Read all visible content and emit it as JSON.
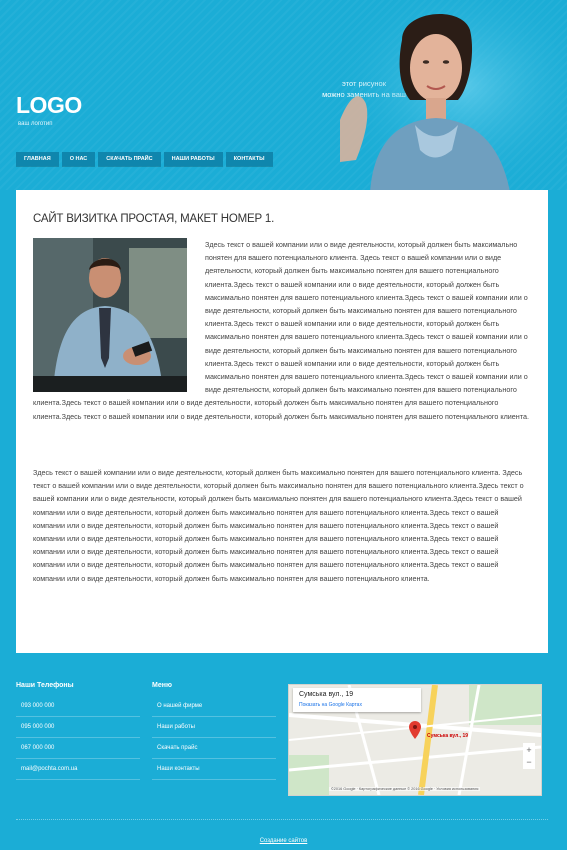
{
  "header": {
    "logo": "LOGO",
    "logo_sub": "ваш логотип",
    "hero_caption_line1": "этот рисунок",
    "hero_caption_line2": "можно заменить на ваш",
    "nav": [
      {
        "label": "ГЛАВНАЯ"
      },
      {
        "label": "О НАС"
      },
      {
        "label": "СКАЧАТЬ ПРАЙС"
      },
      {
        "label": "НАШИ РАБОТЫ"
      },
      {
        "label": "КОНТАКТЫ"
      }
    ]
  },
  "content": {
    "title": "САЙТ ВИЗИТКА ПРОСТАЯ, МАКЕТ НОМЕР 1.",
    "paragraph1": "Здесь текст о вашей компании или о виде деятельности, который должен быть максимально понятен для вашего потенциального клиента. Здесь текст о вашей компании или о виде деятельности, который должен быть максимально понятен для вашего потенциального клиента.Здесь текст о вашей компании или о виде деятельности, который должен быть максимально понятен для вашего потенциального клиента.Здесь текст о вашей компании или о виде деятельности, который должен быть максимально понятен для вашего потенциального клиента.Здесь текст о вашей компании или о виде деятельности, который должен быть максимально понятен для вашего потенциального клиента.Здесь текст о вашей компании или о виде деятельности, который должен быть максимально понятен для вашего потенциального клиента.Здесь текст о вашей компании или о виде деятельности, который должен быть максимально понятен для вашего потенциального клиента.Здесь текст о вашей компании или о виде деятельности, который должен быть максимально понятен для вашего потенциального клиента.Здесь текст о вашей компании или о виде деятельности, который должен быть максимально понятен для вашего потенциального клиента.Здесь текст о вашей компании или о виде деятельности, который должен быть максимально понятен для вашего потенциального клиента.",
    "paragraph2": "Здесь текст о вашей компании или о виде деятельности, который должен быть максимально понятен для вашего потенциального клиента. Здесь текст о вашей компании или о виде деятельности, который должен быть максимально понятен для вашего потенциального клиента.Здесь текст о вашей компании или о виде деятельности, который должен быть максимально понятен для вашего потенциального клиента.Здесь текст о вашей компании или о виде деятельности, который должен быть максимально понятен для вашего потенциального клиента.Здесь текст о вашей компании или о виде деятельности, который должен быть максимально понятен для вашего потенциального клиента.Здесь текст о вашей компании или о виде деятельности, который должен быть максимально понятен для вашего потенциального клиента.Здесь текст о вашей компании или о виде деятельности, который должен быть максимально понятен для вашего потенциального клиента.Здесь текст о вашей компании или о виде деятельности, который должен быть максимально понятен для вашего потенциального клиента.Здесь текст о вашей компании или о виде деятельности, который должен быть максимально понятен для вашего потенциального клиента."
  },
  "footer": {
    "phones_title": "Наши Телефоны",
    "phones": [
      "093 000 000",
      "095 000 000",
      "067 000 000",
      "mail@pochta.com.ua"
    ],
    "menu_title": "Меню",
    "menu": [
      "О нашей фирме",
      "Наши работы",
      "Скачать прайс",
      "Наши контакты"
    ],
    "map": {
      "card_title": "Сумська вул., 19",
      "card_link": "Показать на Google Картах",
      "pin_label": "Сумська вул., 19",
      "attribution": "©2016 Google · Картографические данные © 2016 Google · Условия использования"
    },
    "credit": "Создание сайтов"
  },
  "colors": {
    "background": "#1badd6",
    "nav": "#0f86ad",
    "content": "#ffffff"
  }
}
